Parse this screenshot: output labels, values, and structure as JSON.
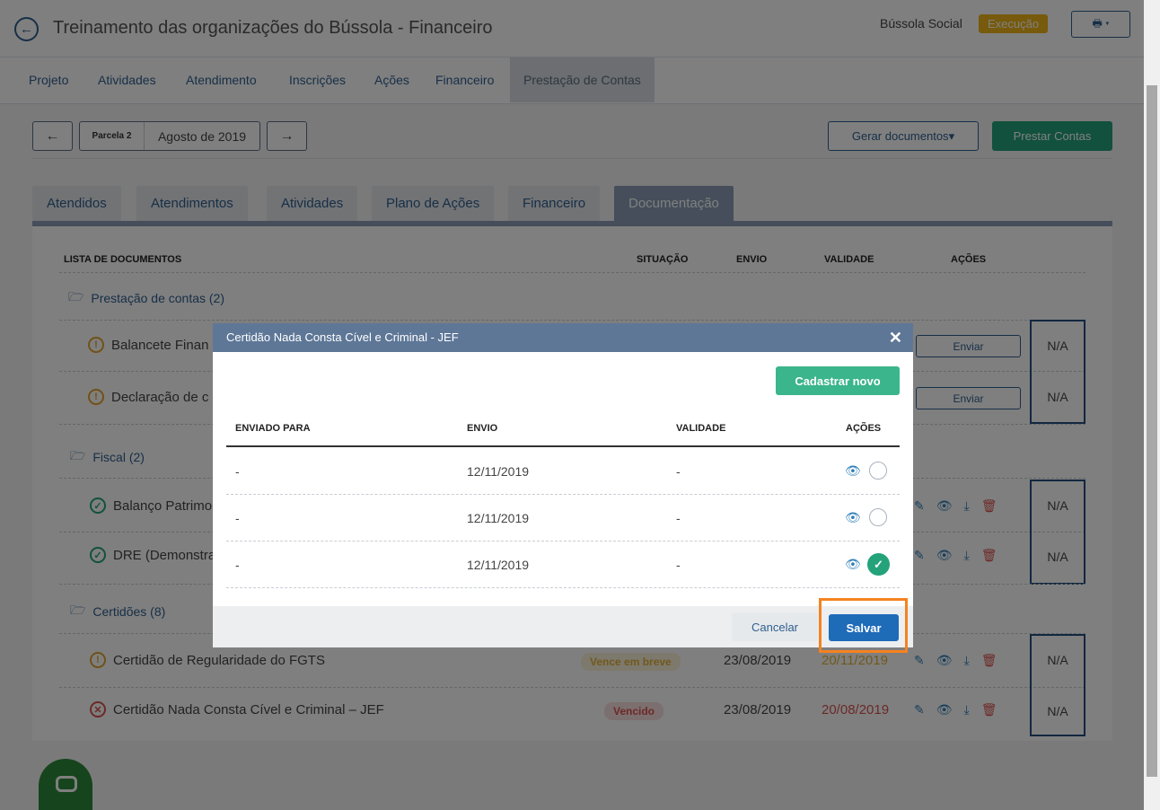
{
  "header": {
    "back_icon": "arrow-left-icon",
    "title": "Treinamento das organizações do Bússola - Financeiro",
    "org": "Bússola Social",
    "status_badge": "Execução",
    "status_color": "#efb518",
    "print_icon": "printer-icon"
  },
  "topnav": [
    "Projeto",
    "Atividades",
    "Atendimento",
    "Inscrições",
    "Ações",
    "Financeiro",
    "Prestação de Contas"
  ],
  "parcela": {
    "prev_icon": "←",
    "next_icon": "→",
    "label": "Parcela 2",
    "value": "Agosto de 2019"
  },
  "actions": {
    "gerar": "Gerar documentos",
    "prestar": "Prestar Contas"
  },
  "tabs": [
    "Atendidos",
    "Atendimentos",
    "Atividades",
    "Plano de Ações",
    "Financeiro",
    "Documentação"
  ],
  "doc_list": {
    "headers": [
      "LISTA DE DOCUMENTOS",
      "SITUAÇÃO",
      "ENVIO",
      "VALIDADE",
      "AÇÕES"
    ],
    "groups": [
      {
        "name": "Prestação de contas (2)",
        "docs": [
          {
            "name": "Balancete Finan",
            "status_icon": "warning-icon",
            "action": "Enviar",
            "na": "N/A"
          },
          {
            "name": "Declaração de c",
            "status_icon": "warning-icon",
            "action": "Enviar",
            "na": "N/A"
          }
        ]
      },
      {
        "name": "Fiscal (2)",
        "docs": [
          {
            "name": "Balanço Patrimo",
            "status_icon": "check-icon",
            "na": "N/A"
          },
          {
            "name": "DRE (Demonstra",
            "status_icon": "check-icon",
            "na": "N/A"
          }
        ]
      },
      {
        "name": "Certidões (8)",
        "docs": [
          {
            "name": "Certidão de Regularidade do FGTS",
            "status_icon": "warning-icon",
            "situacao": "Vence em breve",
            "envio": "23/08/2019",
            "validade": "20/11/2019",
            "na": "N/A"
          },
          {
            "name": "Certidão Nada Consta Cível e Criminal – JEF",
            "status_icon": "error-icon",
            "situacao": "Vencido",
            "envio": "23/08/2019",
            "validade": "20/08/2019",
            "na": "N/A"
          }
        ]
      }
    ]
  },
  "modal": {
    "title": "Certidão Nada Consta Cível e Criminal - JEF",
    "close": "✕",
    "cadastrar": "Cadastrar novo",
    "headers": [
      "ENVIADO PARA",
      "ENVIO",
      "VALIDADE",
      "AÇÕES"
    ],
    "rows": [
      {
        "enviado_para": "-",
        "envio": "12/11/2019",
        "validade": "-",
        "selected": false
      },
      {
        "enviado_para": "-",
        "envio": "12/11/2019",
        "validade": "-",
        "selected": false
      },
      {
        "enviado_para": "-",
        "envio": "12/11/2019",
        "validade": "-",
        "selected": true
      }
    ],
    "cancel": "Cancelar",
    "save": "Salvar"
  }
}
